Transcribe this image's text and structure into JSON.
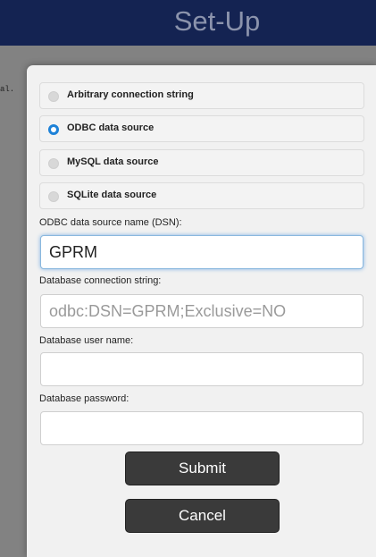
{
  "header": {
    "title": "Set-Up"
  },
  "background": {
    "code_snippet": "al."
  },
  "connection_types": [
    {
      "label": "Arbitrary connection string",
      "selected": false
    },
    {
      "label": "ODBC data source",
      "selected": true
    },
    {
      "label": "MySQL data source",
      "selected": false
    },
    {
      "label": "SQLite data source",
      "selected": false
    }
  ],
  "form": {
    "dsn_label": "ODBC data source name (DSN):",
    "dsn_value": "GPRM",
    "conn_label": "Database connection string:",
    "conn_placeholder": "odbc:DSN=GPRM;Exclusive=NO",
    "user_label": "Database user name:",
    "user_value": "",
    "password_label": "Database password:",
    "password_value": ""
  },
  "buttons": {
    "submit_label": "Submit",
    "cancel_label": "Cancel"
  },
  "colors": {
    "header_bg": "#142352",
    "radio_selected": "#1e82d8",
    "button_bg": "#3a3a3a"
  }
}
